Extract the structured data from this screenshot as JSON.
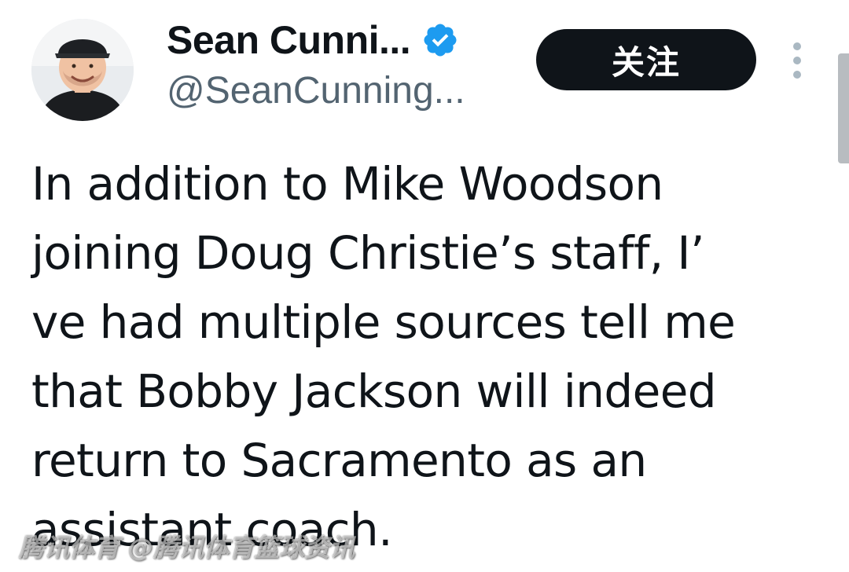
{
  "author": {
    "display_name": "Sean Cunni...",
    "handle": "@SeanCunning...",
    "avatar_icon": "person-avatar",
    "verified_icon": "verified-badge-icon",
    "verified_color": "#1d9bf0"
  },
  "actions": {
    "follow_label": "关注",
    "more_icon": "more-vertical-icon"
  },
  "tweet": {
    "lines": [
      "In addition to Mike Woodson",
      "joining Doug Christie’s staff, I’",
      "ve had multiple sources tell me",
      "that Bobby Jackson will indeed",
      "return to Sacramento as an",
      "assistant coach."
    ]
  },
  "watermark": {
    "text": "腾讯体育 @腾讯体育篮球资讯"
  },
  "colors": {
    "text_primary": "#0f1419",
    "text_secondary": "#536471",
    "button_bg": "#0f1419",
    "button_text": "#ffffff"
  }
}
